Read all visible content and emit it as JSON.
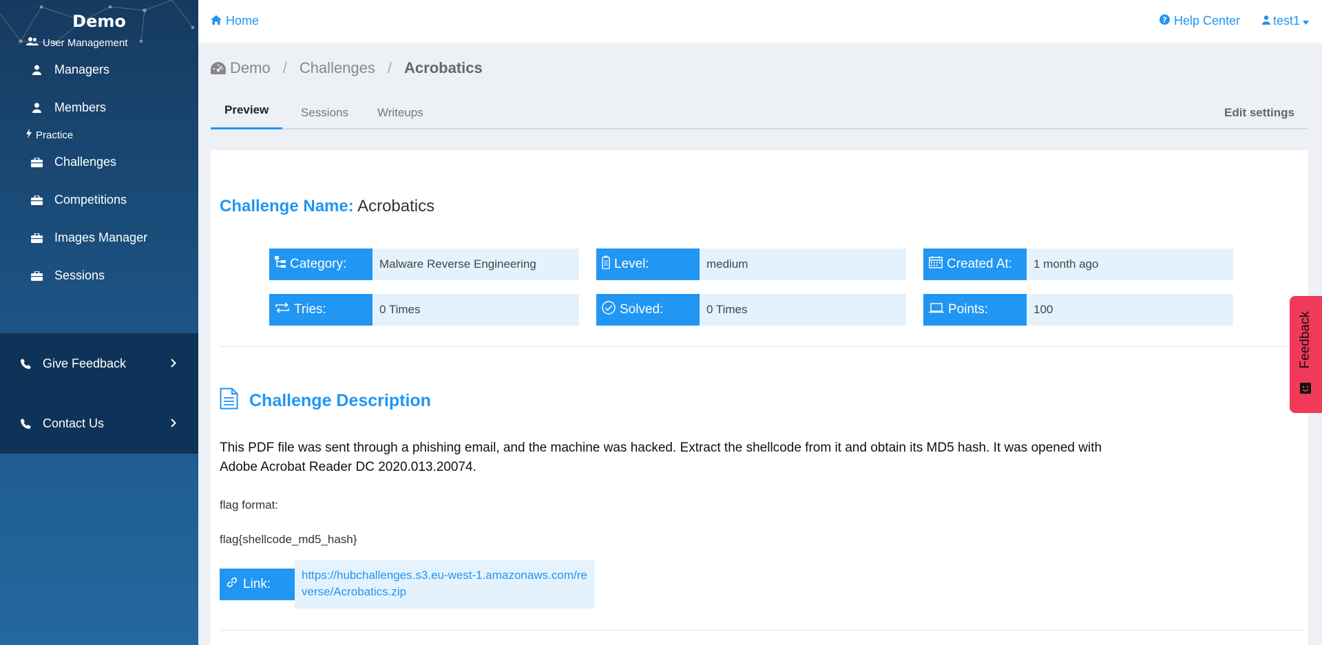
{
  "sidebar": {
    "brand": "Demo",
    "section_user": "User Management",
    "managers": "Managers",
    "members": "Members",
    "section_practice": "Practice",
    "challenges": "Challenges",
    "competitions": "Competitions",
    "images_manager": "Images Manager",
    "sessions": "Sessions",
    "give_feedback": "Give Feedback",
    "contact_us": "Contact Us"
  },
  "topbar": {
    "home": "Home",
    "help_center": "Help Center",
    "user": "test1"
  },
  "breadcrumb": {
    "root": "Demo",
    "section": "Challenges",
    "current": "Acrobatics",
    "separator": "/"
  },
  "tabs": {
    "preview": "Preview",
    "sessions": "Sessions",
    "writeups": "Writeups",
    "edit_settings": "Edit settings"
  },
  "challenge": {
    "name_label": "Challenge Name:",
    "name": "Acrobatics",
    "category_label": "Category:",
    "category": "Malware Reverse Engineering",
    "level_label": "Level:",
    "level": "medium",
    "created_label": "Created At:",
    "created": "1 month ago",
    "tries_label": "Tries:",
    "tries": "0 Times",
    "solved_label": "Solved:",
    "solved": "0 Times",
    "points_label": "Points:",
    "points": "100"
  },
  "description": {
    "heading": "Challenge Description",
    "body": "This PDF file was sent through a phishing email, and the machine was hacked. Extract the shellcode from it and obtain its MD5 hash. It was opened with Adobe Acrobat Reader DC 2020.013.20074.",
    "flag_format_label": "flag format:",
    "flag_format": "flag{shellcode_md5_hash}",
    "link_label": "Link:",
    "link": "https://hubchallenges.s3.eu-west-1.amazonaws.com/reverse/Acrobatics.zip"
  },
  "feedback_tab": "Feedback",
  "colors": {
    "accent": "#2196f3",
    "sidebar": "#1d5688",
    "feedback": "#f1395a"
  }
}
